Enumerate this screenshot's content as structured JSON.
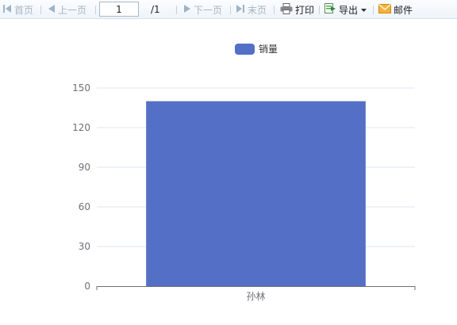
{
  "toolbar": {
    "first_label": "首页",
    "prev_label": "上一页",
    "page_value": "1",
    "page_total": "/1",
    "next_label": "下一页",
    "last_label": "末页",
    "print_label": "打印",
    "export_label": "导出",
    "mail_label": "邮件"
  },
  "colors": {
    "bar": "#5470c6",
    "axis": "#6e7079",
    "grid": "#e0e6f1"
  },
  "chart_data": {
    "type": "bar",
    "categories": [
      "孙林"
    ],
    "series": [
      {
        "name": "销量",
        "values": [
          140
        ]
      }
    ],
    "ylim": [
      0,
      150
    ],
    "yticks": [
      0,
      30,
      60,
      90,
      120,
      150
    ],
    "legend": "top-center",
    "grid": true
  }
}
